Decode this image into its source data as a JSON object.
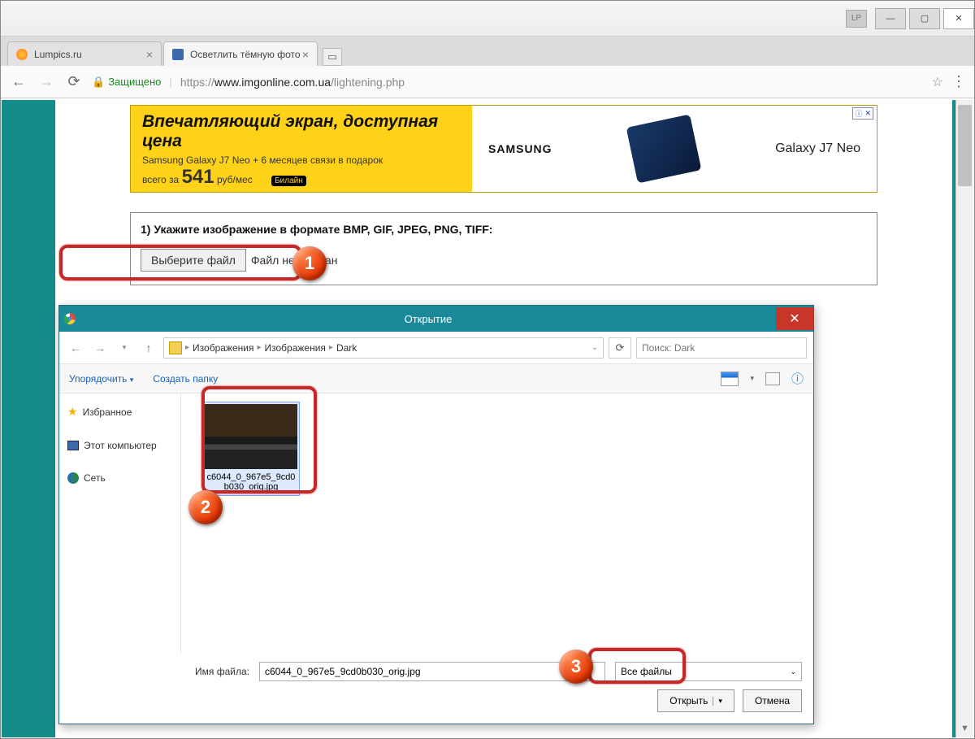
{
  "browser": {
    "lp_badge": "LP",
    "tabs": [
      {
        "label": "Lumpics.ru",
        "active": false
      },
      {
        "label": "Осветлить тёмную фото",
        "active": true
      }
    ],
    "secure_label": "Защищено",
    "url_prefix": "https://",
    "url_host": "www.imgonline.com.ua",
    "url_path": "/lightening.php"
  },
  "ad": {
    "headline": "Впечатляющий экран, доступная цена",
    "subline": "Samsung Galaxy J7 Neo + 6 месяцев связи в подарок",
    "price_prefix": "всего за",
    "price_value": "541",
    "price_suffix": "руб/мес",
    "carrier": "Билайн",
    "brand": "SAMSUNG",
    "product": "Galaxy J7 Neo",
    "ad_tag": "✕"
  },
  "step1": {
    "heading": "1) Укажите изображение в формате BMP, GIF, JPEG, PNG, TIFF:",
    "choose_btn": "Выберите файл",
    "status": "Файл не выбран"
  },
  "dialog": {
    "title": "Открытие",
    "breadcrumb": [
      "Изображения",
      "Изображения",
      "Dark"
    ],
    "search_placeholder": "Поиск: Dark",
    "organize": "Упорядочить",
    "new_folder": "Создать папку",
    "sidebar": {
      "favorites": "Избранное",
      "this_pc": "Этот компьютер",
      "network": "Сеть"
    },
    "file_name": "c6044_0_967e5_9cd0b030_orig.jpg",
    "name_label": "Имя файла:",
    "name_value": "c6044_0_967e5_9cd0b030_orig.jpg",
    "type_value": "Все файлы",
    "open_btn": "Открыть",
    "cancel_btn": "Отмена"
  },
  "markers": {
    "m1": "1",
    "m2": "2",
    "m3": "3"
  }
}
